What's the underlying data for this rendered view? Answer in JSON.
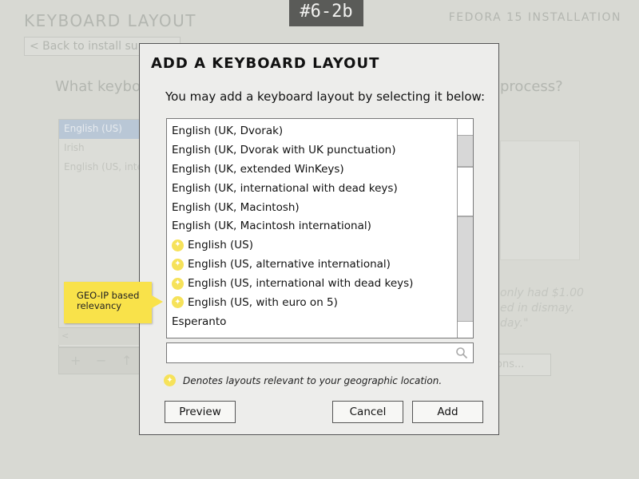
{
  "background": {
    "title": "KEYBOARD LAYOUT",
    "installer_title": "FEDORA 15 INSTALLATION",
    "back_button": "< Back to install su",
    "question_start": "What keyboa",
    "question_end": "process?",
    "layouts": [
      "English (US)",
      "Irish",
      "English (US, inte"
    ],
    "toolbar": {
      "add": "+",
      "remove": "−",
      "up": "↑"
    },
    "quote_lines": [
      "only had $1.00",
      "ed in dismay.",
      "day.\""
    ],
    "options_button": "ons..."
  },
  "tag": "#6-2b",
  "dialog": {
    "title": "ADD A KEYBOARD LAYOUT",
    "prompt": "You may add a keyboard layout by selecting it below:",
    "layouts": [
      {
        "label": "English (UK, Dvorak)",
        "geo": false
      },
      {
        "label": "English (UK, Dvorak with UK punctuation)",
        "geo": false
      },
      {
        "label": "English (UK, extended WinKeys)",
        "geo": false
      },
      {
        "label": "English (UK, international with dead keys)",
        "geo": false
      },
      {
        "label": "English (UK, Macintosh)",
        "geo": false
      },
      {
        "label": "English (UK, Macintosh international)",
        "geo": false
      },
      {
        "label": "English (US)",
        "geo": true
      },
      {
        "label": "English (US, alternative international)",
        "geo": true
      },
      {
        "label": "English (US, international with dead keys)",
        "geo": true
      },
      {
        "label": "English (US, with euro on 5)",
        "geo": true
      },
      {
        "label": "Esperanto",
        "geo": false
      }
    ],
    "search": {
      "value": "",
      "placeholder": ""
    },
    "legend": "Denotes layouts relevant to your geographic location.",
    "buttons": {
      "preview": "Preview",
      "cancel": "Cancel",
      "add": "Add"
    }
  },
  "callout": {
    "line1": "GEO-IP based",
    "line2": "relevancy"
  },
  "colors": {
    "star": "#f6e25a",
    "callout": "#f9e24a",
    "tag_bg": "#5a5b58",
    "bg_selection": "#b9c7d6"
  },
  "icons": {
    "geo_marker": "star-icon",
    "search": "search-icon"
  }
}
